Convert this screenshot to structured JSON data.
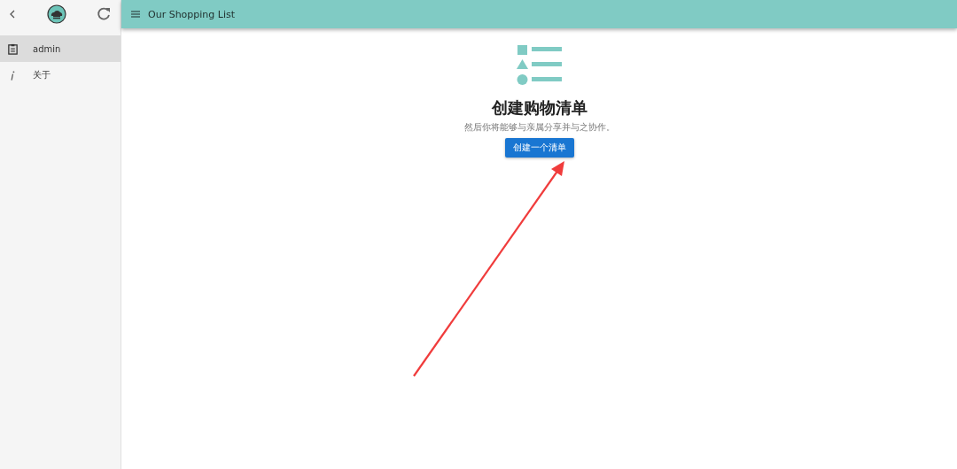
{
  "sidebar": {
    "items": [
      {
        "kind": "clipboard",
        "label": "admin",
        "selected": true
      },
      {
        "kind": "info",
        "label": "关于",
        "selected": false
      }
    ]
  },
  "app_bar": {
    "title": "Our Shopping List"
  },
  "empty_state": {
    "title": "创建购物清单",
    "subtitle": "然后你将能够与亲属分享并与之协作。",
    "button": "创建一个清单"
  },
  "annotation": {
    "kind": "arrow"
  }
}
